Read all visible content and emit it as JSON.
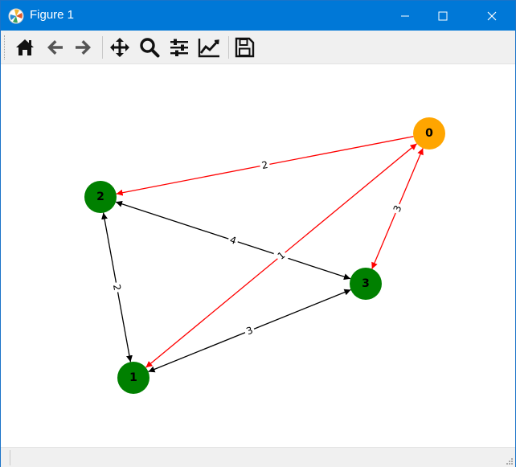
{
  "window": {
    "title": "Figure 1"
  },
  "colors": {
    "titlebar": "#0078d7",
    "node_highlight": "#ffa500",
    "node_default": "#008000",
    "edge_highlight": "#ff0000",
    "edge_default": "#000000"
  },
  "toolbar": {
    "buttons": [
      {
        "id": "home",
        "icon": "home-icon"
      },
      {
        "id": "back",
        "icon": "arrow-left-icon"
      },
      {
        "id": "forward",
        "icon": "arrow-right-icon"
      },
      {
        "id": "pan",
        "icon": "move-icon"
      },
      {
        "id": "zoom",
        "icon": "magnifier-icon"
      },
      {
        "id": "subplots",
        "icon": "sliders-icon"
      },
      {
        "id": "axes",
        "icon": "line-chart-icon"
      },
      {
        "id": "save",
        "icon": "floppy-disk-icon"
      }
    ]
  },
  "graph": {
    "nodes": [
      {
        "id": "0",
        "label": "0",
        "color": "#ffa500"
      },
      {
        "id": "1",
        "label": "1",
        "color": "#008000"
      },
      {
        "id": "2",
        "label": "2",
        "color": "#008000"
      },
      {
        "id": "3",
        "label": "3",
        "color": "#008000"
      }
    ],
    "edges": [
      {
        "source": "0",
        "target": "2",
        "weight": "2",
        "color": "#ff0000",
        "bidirectional": false
      },
      {
        "source": "0",
        "target": "3",
        "weight": "3",
        "color": "#ff0000",
        "bidirectional": true
      },
      {
        "source": "0",
        "target": "1",
        "weight": "1",
        "color": "#ff0000",
        "bidirectional": true
      },
      {
        "source": "2",
        "target": "3",
        "weight": "4",
        "color": "#000000",
        "bidirectional": true
      },
      {
        "source": "2",
        "target": "1",
        "weight": "2",
        "color": "#000000",
        "bidirectional": true
      },
      {
        "source": "1",
        "target": "3",
        "weight": "3",
        "color": "#000000",
        "bidirectional": true
      }
    ]
  }
}
